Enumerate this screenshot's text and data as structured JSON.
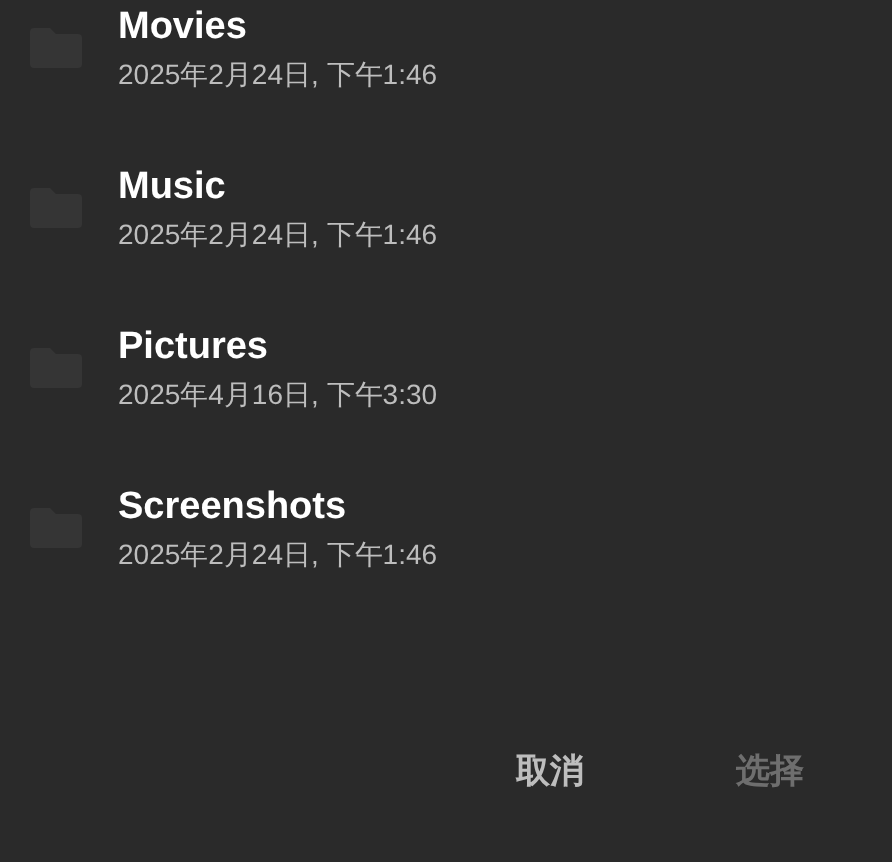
{
  "folders": [
    {
      "name": "Movies",
      "date": "2025年2月24日, 下午1:46"
    },
    {
      "name": "Music",
      "date": "2025年2月24日, 下午1:46"
    },
    {
      "name": "Pictures",
      "date": "2025年4月16日, 下午3:30"
    },
    {
      "name": "Screenshots",
      "date": "2025年2月24日, 下午1:46"
    }
  ],
  "buttons": [
    {
      "label": "取消",
      "disabled": false
    },
    {
      "label": "选择",
      "disabled": true
    }
  ]
}
